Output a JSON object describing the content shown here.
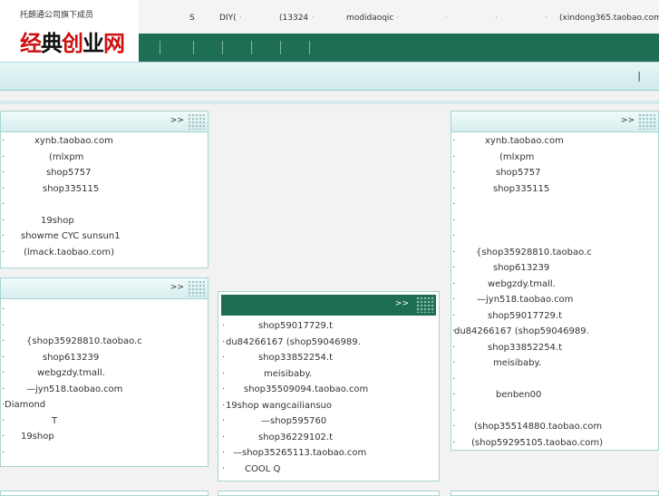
{
  "logo": {
    "subtitle": "托朗通公司旗下成员",
    "chars": [
      {
        "ch": "经",
        "color": "#cc1010"
      },
      {
        "ch": "典",
        "color": "#111111"
      },
      {
        "ch": "创",
        "color": "#cc1010"
      },
      {
        "ch": "业",
        "color": "#111111"
      },
      {
        "ch": "网",
        "color": "#cc1010"
      }
    ]
  },
  "topbar": {
    "items": [
      {
        "text": "S"
      },
      {
        "text": "DIY("
      },
      {
        "text": "·"
      },
      {
        "text": "(13324"
      },
      {
        "text": "·"
      },
      {
        "text": "modidaoqic"
      },
      {
        "text": "·"
      },
      {
        "text": "·"
      },
      {
        "text": "·"
      },
      {
        "text": "·"
      },
      {
        "text": "(xindong365.taobao.com"
      }
    ]
  },
  "subbar": {
    "pipe": "|"
  },
  "more_label": ">>",
  "left_top": {
    "rows": [
      {
        "text": "xynb.taobao.com"
      },
      {
        "text": "(mlxpm"
      },
      {
        "text": "shop5757"
      },
      {
        "text": "shop335115"
      },
      {
        "text": ""
      },
      {
        "text": "19shop"
      },
      {
        "text": "showme    CYC sunsun1"
      },
      {
        "text": "(lmack.taobao.com)"
      }
    ]
  },
  "left_bottom": {
    "rows": [
      {
        "text": ""
      },
      {
        "text": ""
      },
      {
        "text": "{shop35928810.taobao.c"
      },
      {
        "text": "shop613239"
      },
      {
        "text": "webgzdy.tmall."
      },
      {
        "text": "—jyn518.taobao.com"
      },
      {
        "text": "Diamond"
      },
      {
        "text": "T"
      },
      {
        "text": "19shop"
      },
      {
        "text": ""
      }
    ]
  },
  "middle": {
    "rows": [
      {
        "text": "shop59017729.t"
      },
      {
        "text": "du84266167       (shop59046989."
      },
      {
        "text": "shop33852254.t"
      },
      {
        "text": "meisibaby."
      },
      {
        "text": "shop35509094.taobao.com"
      },
      {
        "text": "19shop     wangcailiansuo"
      },
      {
        "text": "—shop595760"
      },
      {
        "text": "shop36229102.t"
      },
      {
        "text": "—shop35265113.taobao.com"
      },
      {
        "text": "COOL          Q"
      }
    ]
  },
  "right": {
    "rows": [
      {
        "text": "xynb.taobao.com"
      },
      {
        "text": "(mlxpm"
      },
      {
        "text": "shop5757"
      },
      {
        "text": "shop335115"
      },
      {
        "text": ""
      },
      {
        "text": ""
      },
      {
        "text": ""
      },
      {
        "text": "{shop35928810.taobao.c"
      },
      {
        "text": "shop613239"
      },
      {
        "text": "webgzdy.tmall."
      },
      {
        "text": "—jyn518.taobao.com"
      },
      {
        "text": "shop59017729.t"
      },
      {
        "text": "du84266167       (shop59046989."
      },
      {
        "text": "shop33852254.t"
      },
      {
        "text": "meisibaby."
      },
      {
        "text": ""
      },
      {
        "text": "benben00"
      },
      {
        "text": ""
      },
      {
        "text": "(shop35514880.taobao.com"
      },
      {
        "text": "(shop59295105.taobao.com)"
      }
    ]
  }
}
